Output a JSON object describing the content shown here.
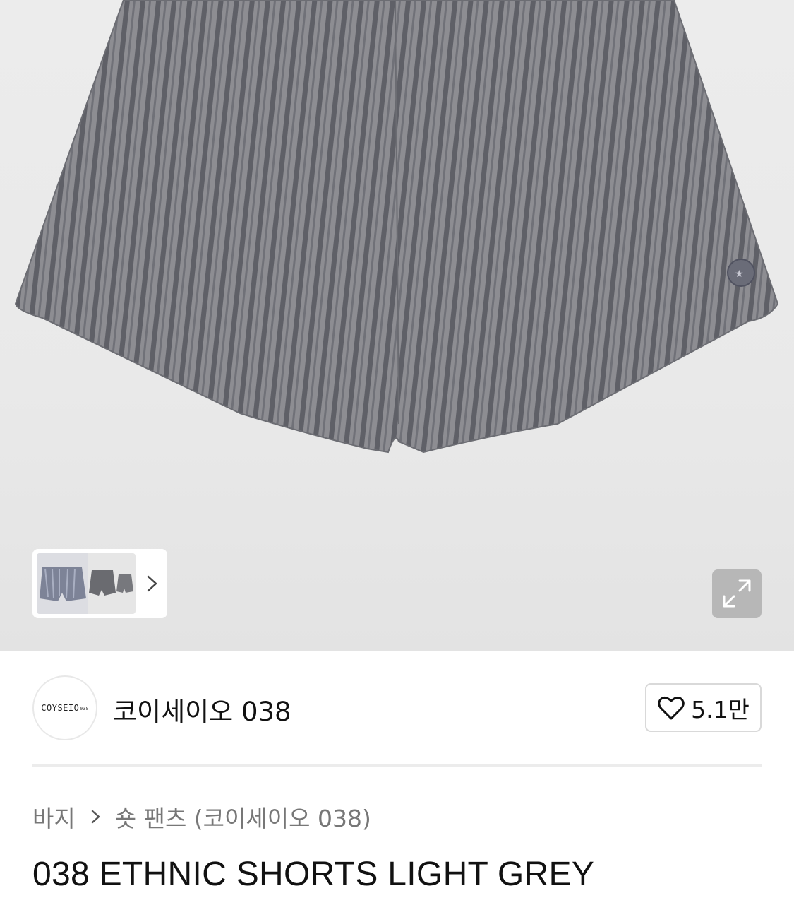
{
  "product_image": {
    "thumbnail_next_icon": "chevron-right-icon",
    "expand_icon": "expand-arrows-icon"
  },
  "brand": {
    "logo_text": "COYSEIO",
    "logo_subtext": "038",
    "name": "코이세이오 038"
  },
  "like": {
    "icon": "heart-outline-icon",
    "count": "5.1만"
  },
  "breadcrumb": {
    "category": "바지",
    "subcategory": "숏 팬츠 (코이세이오 038)",
    "separator_icon": "chevron-right-icon"
  },
  "product": {
    "title": "038 ETHNIC SHORTS LIGHT GREY"
  },
  "colors": {
    "fabric": "#8a8a8e",
    "stripe": "#5e5f66",
    "background": "#ececec",
    "expand_button": "#b7b7b7"
  }
}
